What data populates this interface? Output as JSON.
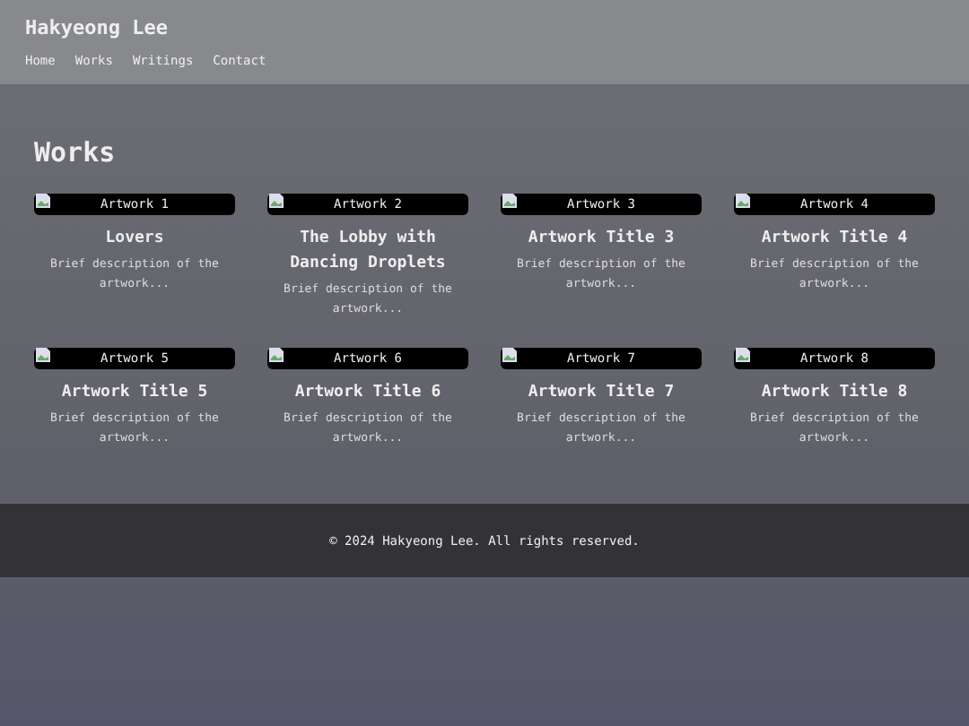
{
  "header": {
    "title": "Hakyeong Lee",
    "nav": [
      "Home",
      "Works",
      "Writings",
      "Contact"
    ]
  },
  "section_title": "Works",
  "artworks": [
    {
      "image_alt": "Artwork 1",
      "title": "Lovers",
      "description": "Brief description of the artwork..."
    },
    {
      "image_alt": "Artwork 2",
      "title": "The Lobby with Dancing Droplets",
      "description": "Brief description of the artwork..."
    },
    {
      "image_alt": "Artwork 3",
      "title": "Artwork Title 3",
      "description": "Brief description of the artwork..."
    },
    {
      "image_alt": "Artwork 4",
      "title": "Artwork Title 4",
      "description": "Brief description of the artwork..."
    },
    {
      "image_alt": "Artwork 5",
      "title": "Artwork Title 5",
      "description": "Brief description of the artwork..."
    },
    {
      "image_alt": "Artwork 6",
      "title": "Artwork Title 6",
      "description": "Brief description of the artwork..."
    },
    {
      "image_alt": "Artwork 7",
      "title": "Artwork Title 7",
      "description": "Brief description of the artwork..."
    },
    {
      "image_alt": "Artwork 8",
      "title": "Artwork Title 8",
      "description": "Brief description of the artwork..."
    }
  ],
  "footer": "© 2024 Hakyeong Lee. All rights reserved."
}
